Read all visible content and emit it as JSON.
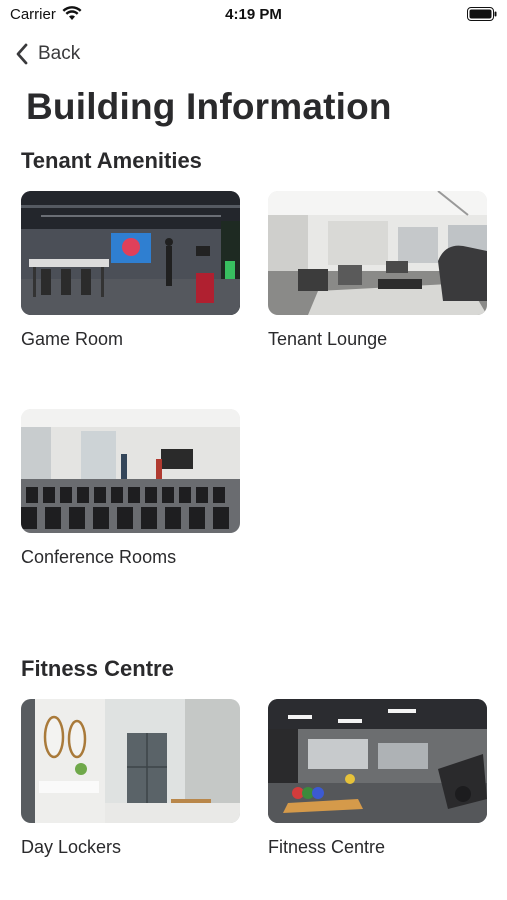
{
  "status_bar": {
    "carrier": "Carrier",
    "time": "4:19 PM",
    "wifi_icon": "wifi-icon",
    "battery_icon": "battery-icon"
  },
  "nav": {
    "back_label": "Back",
    "back_icon": "chevron-left-icon"
  },
  "page": {
    "title": "Building Information"
  },
  "sections": [
    {
      "title": "Tenant Amenities",
      "items": [
        {
          "label": "Game Room"
        },
        {
          "label": "Tenant Lounge"
        },
        {
          "label": "Conference Rooms"
        }
      ]
    },
    {
      "title": "Fitness Centre",
      "items": [
        {
          "label": "Day Lockers"
        },
        {
          "label": "Fitness Centre"
        }
      ]
    }
  ]
}
